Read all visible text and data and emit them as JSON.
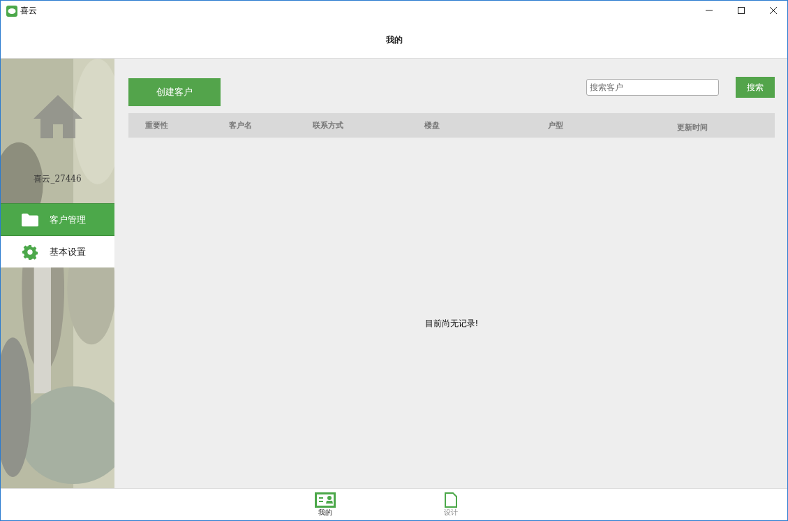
{
  "window": {
    "title": "喜云",
    "heading": "我的"
  },
  "sidebar": {
    "user": "喜云_27446",
    "items": [
      {
        "kind": "folder",
        "label": "客户管理",
        "selected": true
      },
      {
        "kind": "gear",
        "label": "基本设置",
        "selected": false
      }
    ]
  },
  "toolbar": {
    "create": "创建客户",
    "search": {
      "placeholder": "搜索客户"
    },
    "search_button": "搜索"
  },
  "table": {
    "columns": [
      "重要性",
      "客户名",
      "联系方式",
      "楼盘",
      "户型",
      "更新时间"
    ],
    "empty": "目前尚无记录!"
  },
  "bottom_tabs": [
    {
      "kind": "card",
      "label": "我的",
      "selected": true
    },
    {
      "kind": "page",
      "label": "设计",
      "selected": false
    }
  ]
}
